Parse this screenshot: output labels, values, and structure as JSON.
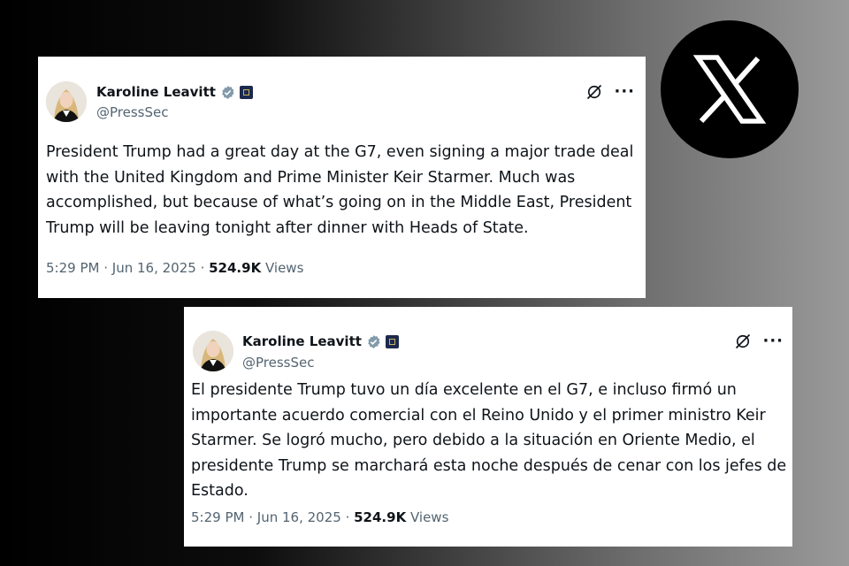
{
  "brand": {
    "logo_icon": "x-logo-icon",
    "logo_color": "#000000"
  },
  "colors": {
    "verified": "#1d9bf0",
    "text": "#0f1419",
    "secondary": "#536471"
  },
  "tweets": [
    {
      "display_name": "Karoline Leavitt",
      "handle": "@PressSec",
      "text": "President Trump had a great day at the G7, even signing a major trade deal with the United Kingdom and Prime Minister Keir Starmer. Much was accomplished, but because of what’s going on in the Middle East, President Trump will be leaving tonight after dinner with Heads of State.",
      "time": "5:29 PM",
      "date": "Jun 16, 2025",
      "views_count": "524.9K",
      "views_label": "Views",
      "more_label": "···"
    },
    {
      "display_name": "Karoline Leavitt",
      "handle": "@PressSec",
      "text": "El presidente Trump tuvo un día excelente en el G7, e incluso firmó un importante acuerdo comercial con el Reino Unido y el primer ministro Keir Starmer. Se logró mucho, pero debido a la situación en Oriente Medio, el presidente Trump se marchará esta noche después de cenar con los jefes de Estado.",
      "time": "5:29 PM",
      "date": "Jun 16, 2025",
      "views_count": "524.9K",
      "views_label": "Views",
      "more_label": "···"
    }
  ]
}
